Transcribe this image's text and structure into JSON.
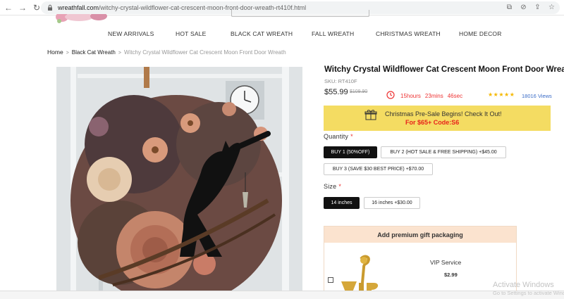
{
  "browser": {
    "url_host": "wreathfall.com",
    "url_path": "/witchy-crystal-wildflower-cat-crescent-moon-front-door-wreath-rt410f.html"
  },
  "nav": {
    "items": [
      "NEW ARRIVALS",
      "HOT SALE",
      "BLACK CAT WREATH",
      "FALL WREATH",
      "CHRISTMAS WREATH",
      "HOME DECOR"
    ]
  },
  "breadcrumb": {
    "home": "Home",
    "category": "Black Cat Wreath",
    "current": "Witchy Crystal Wildflower Cat Crescent Moon Front Door Wreath"
  },
  "product": {
    "title": "Witchy Crystal Wildflower Cat Crescent Moon Front Door Wreath",
    "sku": "SKU: RT410F",
    "price": "$55.99",
    "old_price": "$109.90",
    "countdown": {
      "hours": "15hours",
      "mins": "23mins",
      "secs": "46sec"
    },
    "stars": "★★★★★",
    "rating": 5,
    "reviews": "18016 Views"
  },
  "promo": {
    "line1": "Christmas Pre-Sale Begins! Check It Out!",
    "line2": "For $65+ Code:S6"
  },
  "quantity": {
    "label": "Quantity",
    "required_mark": "*",
    "options": [
      "BUY 1 (50%OFF)",
      "BUY 2 (HOT SALE & FREE SHIPPING) +$45.00",
      "BUY 3 (SAVE $30 BEST PRICE) +$70.00"
    ],
    "selected": "BUY 1 (50%OFF)"
  },
  "size": {
    "label": "Size",
    "required_mark": "*",
    "options": [
      "14 inches",
      "16 inches +$30.00"
    ],
    "selected": "14 inches"
  },
  "gift": {
    "header": "Add premium gift packaging",
    "service": "VIP Service",
    "price": "$2.99"
  },
  "watermark": {
    "line1": "Activate Windows",
    "line2": "Go to Settings to activate Windows."
  },
  "colors": {
    "promo_bg": "#f4dc62",
    "countdown": "#e33333",
    "accent_link": "#3a6cc7",
    "selected_option": "#111111"
  }
}
